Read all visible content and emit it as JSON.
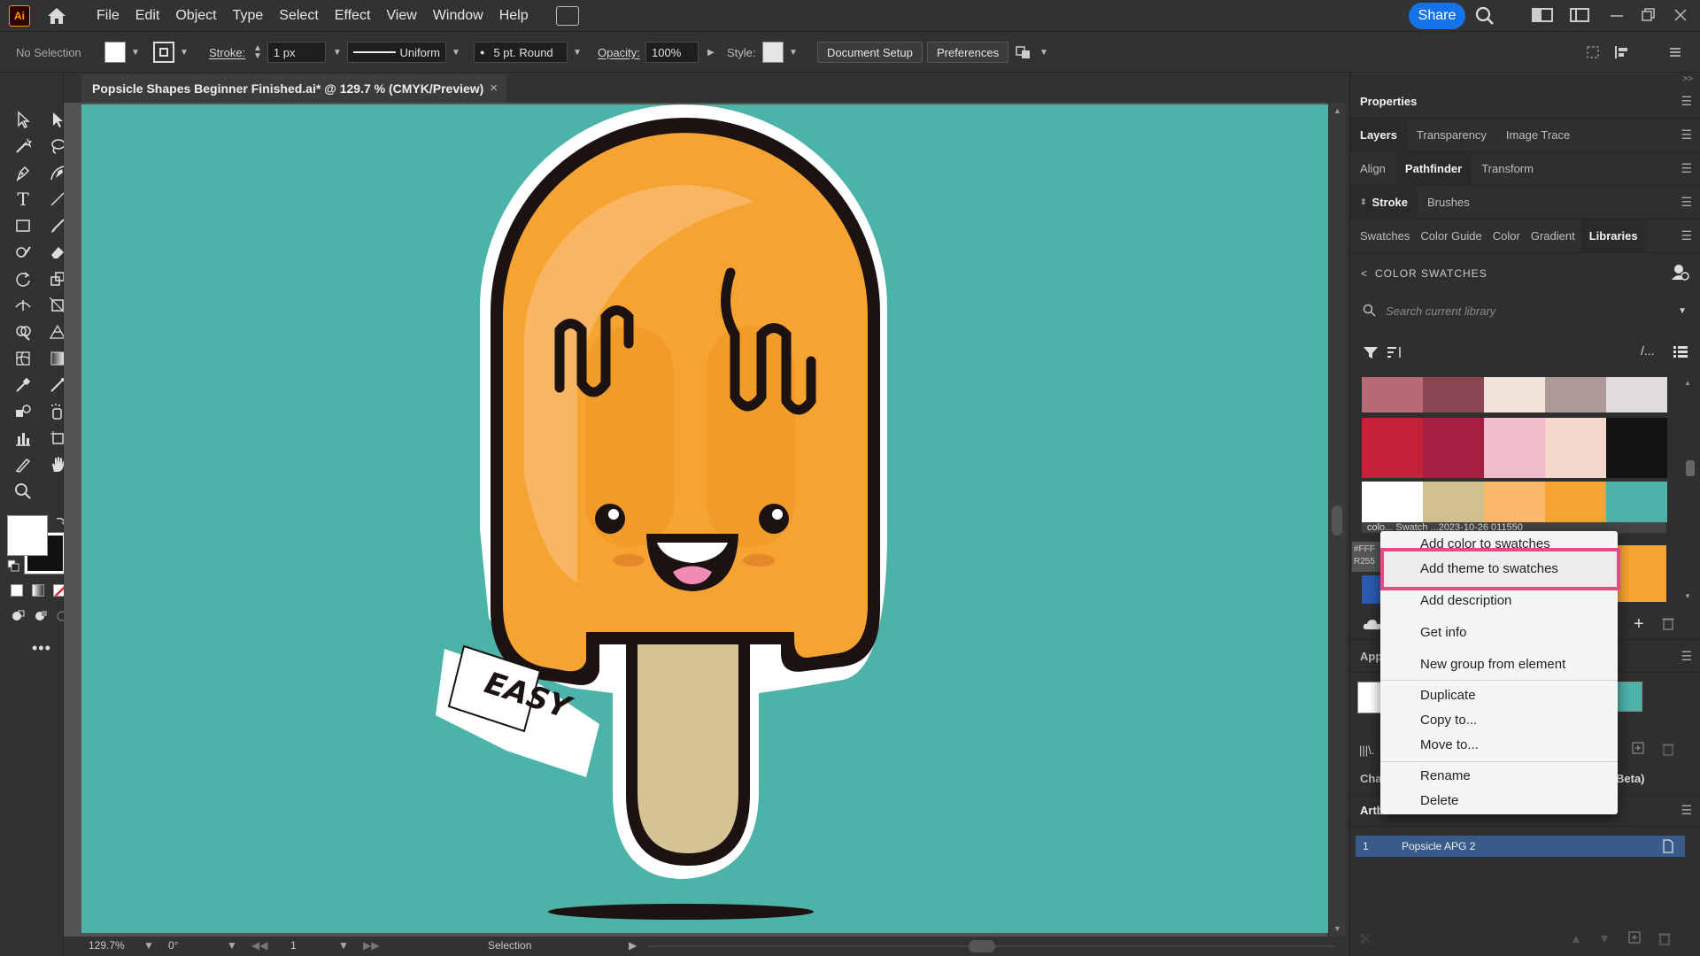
{
  "app": {
    "logo": "Ai"
  },
  "menu": [
    "File",
    "Edit",
    "Object",
    "Type",
    "Select",
    "Effect",
    "View",
    "Window",
    "Help"
  ],
  "header": {
    "share_label": "Share"
  },
  "control": {
    "selection": "No Selection",
    "stroke_label": "Stroke:",
    "stroke_weight": "1 px",
    "profile": "Uniform",
    "brush": "5 pt. Round",
    "opacity_label": "Opacity:",
    "opacity_value": "100%",
    "style_label": "Style:",
    "document_setup": "Document Setup",
    "preferences": "Preferences"
  },
  "document": {
    "tab_title": "Popsicle Shapes Beginner Finished.ai* @ 129.7 % (CMYK/Preview)",
    "close": "×"
  },
  "artwork": {
    "banner_text": "EASY"
  },
  "status": {
    "zoom": "129.7%",
    "rotation": "0°",
    "artboard_num": "1",
    "tool": "Selection"
  },
  "panel": {
    "properties": "Properties",
    "row1": [
      "Layers",
      "Transparency",
      "Image Trace"
    ],
    "row2": [
      "Align",
      "Pathfinder",
      "Transform"
    ],
    "row3": [
      "Stroke",
      "Brushes"
    ],
    "row4": [
      "Swatches",
      "Color Guide",
      "Color",
      "Gradient",
      "Libraries"
    ],
    "library_header": "COLOR SWATCHES",
    "search_placeholder": "Search current library",
    "group_label": "colo... Swatch ...2023-10-26 011550",
    "hex_fragment": "#FFF",
    "rgb_fragment": "R255",
    "app_fragment": "App",
    "char_fragment": "Char",
    "beta_fragment": "Beta)",
    "artboards_tab": "Artboards",
    "artboard_index": "1",
    "artboard_name": "Popsicle APG 2"
  },
  "swatches": {
    "row1": [
      "#b86b75",
      "#8a4854",
      "#f1e4da",
      "#ae9999",
      "#e0dcdb"
    ],
    "row2": [
      "#c4223a",
      "#a61f43",
      "#f2bccb",
      "#f3d6cc",
      "#121212"
    ],
    "row3": [
      "#ffffff",
      "#cfc08e",
      "#f9b86a",
      "#f6a331",
      "#4cb3a8"
    ]
  },
  "context_menu": {
    "items": [
      "Add color to swatches",
      "Add theme to swatches",
      "Add description",
      "Get info",
      "New group from element",
      "Duplicate",
      "Copy to...",
      "Move to...",
      "Rename",
      "Delete"
    ],
    "highlighted": "Add theme to swatches"
  },
  "colors": {
    "artboard": "#4cb3a8",
    "popsicle": "#f6a331",
    "highlight": "#e64b86",
    "share": "#1473e6"
  }
}
